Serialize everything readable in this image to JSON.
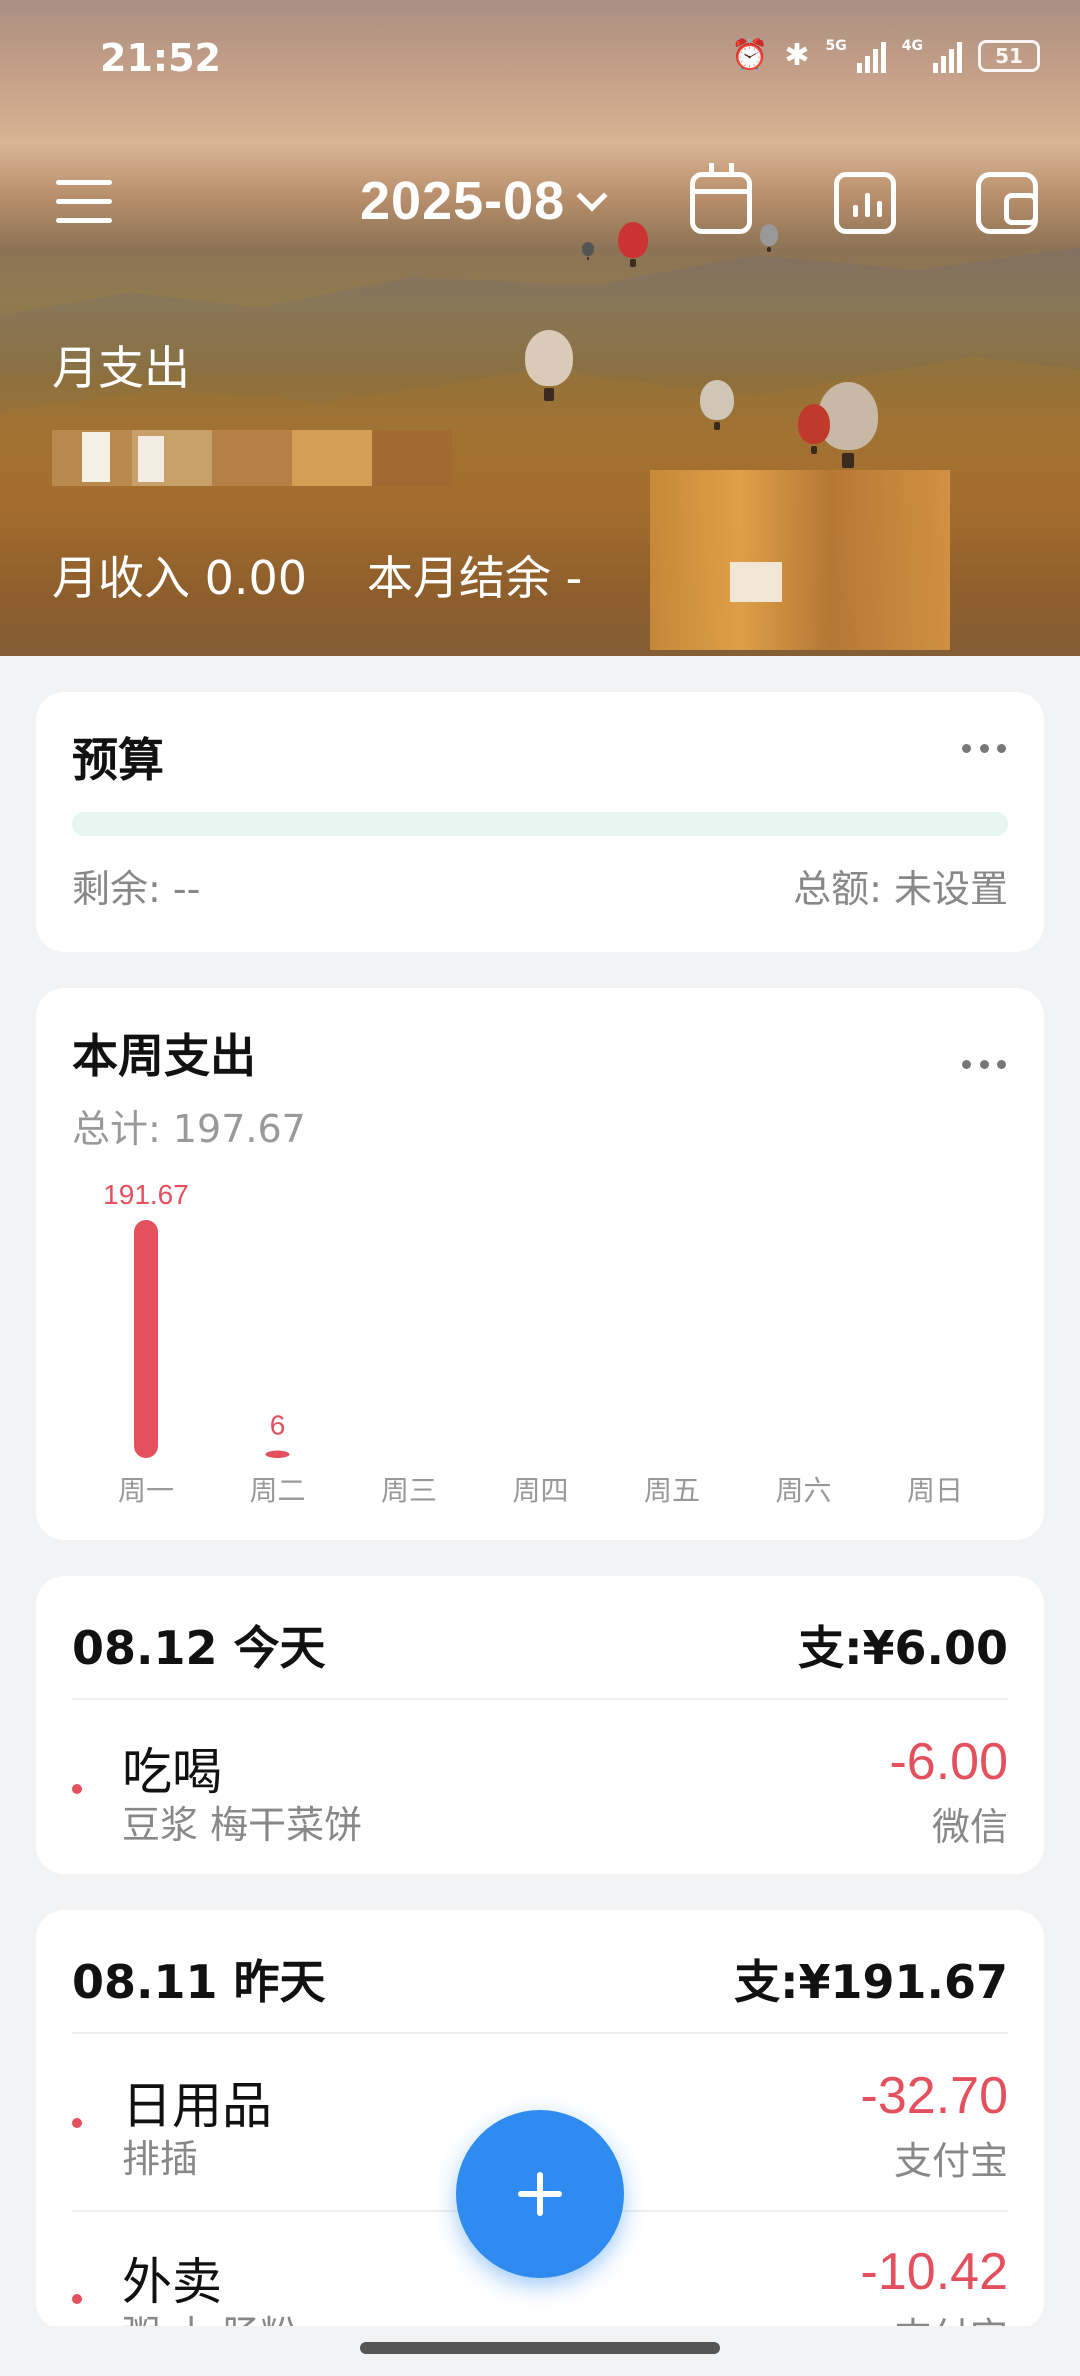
{
  "status_bar": {
    "time": "21:52",
    "net1": "5G",
    "net2": "4G",
    "battery": "51"
  },
  "header": {
    "month": "2025-08",
    "month_expense_label": "月支出",
    "income_label": "月收入 0.00",
    "balance_label": "本月结余 -",
    "icons": [
      "menu-icon",
      "calendar-icon",
      "bar-chart-icon",
      "wallet-icon"
    ]
  },
  "budget": {
    "title": "预算",
    "remaining": "剩余: --",
    "total": "总额: 未设置"
  },
  "week": {
    "title": "本周支出",
    "total": "总计: 197.67",
    "chart_data": {
      "type": "bar",
      "categories": [
        "周一",
        "周二",
        "周三",
        "周四",
        "周五",
        "周六",
        "周日"
      ],
      "values": [
        191.67,
        6,
        0,
        0,
        0,
        0,
        0
      ],
      "value_labels": [
        "191.67",
        "6",
        "",
        "",
        "",
        "",
        ""
      ],
      "color": "#e5505f"
    }
  },
  "days": [
    {
      "date": "08.12 今天",
      "sum": "支:¥6.00",
      "items": [
        {
          "category": "吃喝",
          "note": "豆浆 梅干菜饼",
          "amount": "-6.00",
          "account": "微信"
        }
      ]
    },
    {
      "date": "08.11 昨天",
      "sum": "支:¥191.67",
      "items": [
        {
          "category": "日用品",
          "note": "排插",
          "amount": "-32.70",
          "account": "支付宝"
        },
        {
          "category": "外卖",
          "note": "粥 十 肠粉",
          "amount": "-10.42",
          "account": "支付宝"
        }
      ]
    }
  ],
  "colors": {
    "expense_red": "#e5505f",
    "fab_blue": "#2f8bf0",
    "budget_track": "#e6f5ef"
  }
}
